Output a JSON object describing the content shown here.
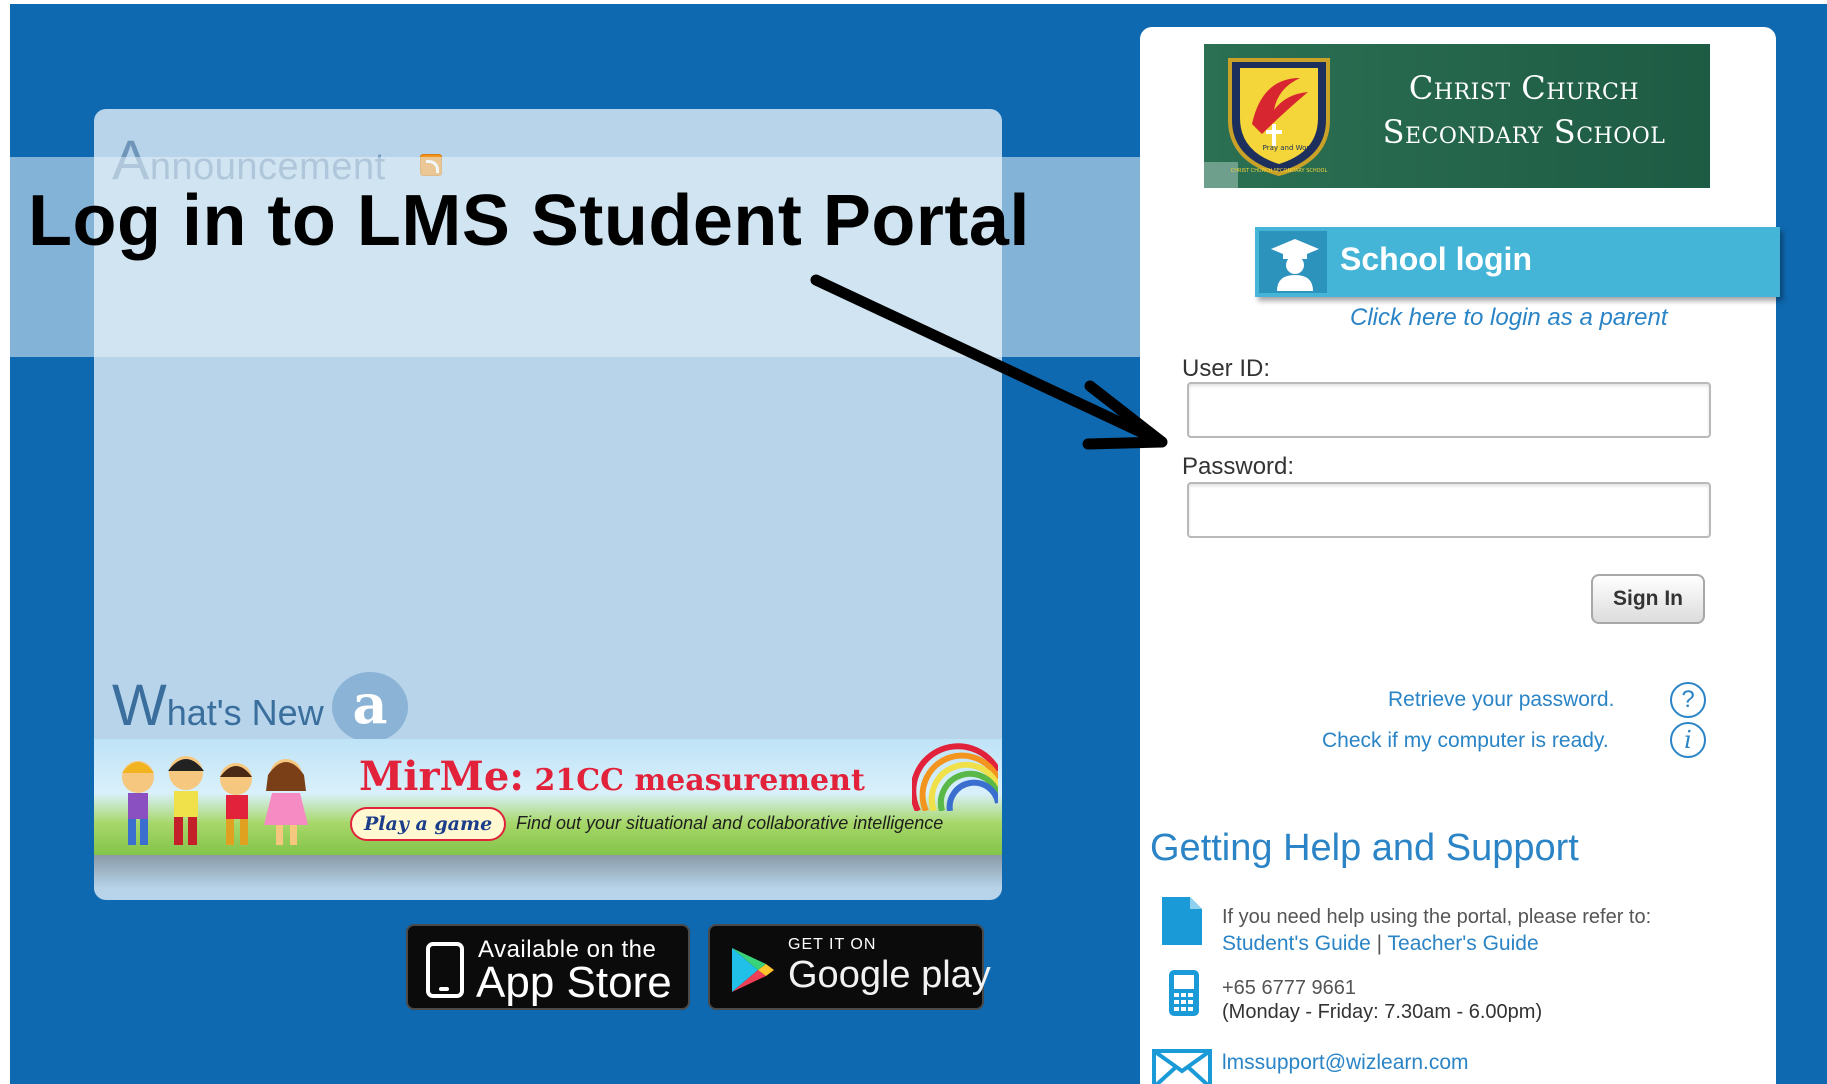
{
  "overlay": {
    "title": "Log in to LMS Student Portal"
  },
  "announcements": {
    "title_first_letter": "A",
    "title_rest": "nnouncement",
    "whats_new_first_letter": "W",
    "whats_new_rest": "hat's New",
    "whats_new_badge": "a"
  },
  "banner": {
    "title_main": "MirMe:",
    "title_sub": " 21CC measurement",
    "play_button": "Play a game",
    "tagline": "Find out your situational and collaborative intelligence"
  },
  "stores": {
    "appstore_line1": "Available on the",
    "appstore_line2": "App Store",
    "googleplay_line1": "GET IT ON",
    "googleplay_line2": "Google play"
  },
  "login": {
    "school_name_line1": "Christ Church",
    "school_name_line2": "Secondary School",
    "crest_motto": "Pray and Work",
    "crest_ring": "CHRIST CHURCH SECONDARY SCHOOL",
    "school_login_label": "School login",
    "parent_link": "Click here to login as a parent",
    "userid_label": "User ID:",
    "userid_value": "",
    "password_label": "Password:",
    "password_value": "",
    "signin_label": "Sign In",
    "retrieve_password": "Retrieve your password.",
    "check_computer": "Check if my computer is ready.",
    "question_icon_glyph": "?",
    "info_icon_glyph": "i"
  },
  "support": {
    "heading": "Getting Help and Support",
    "help_text": "If you need help using the portal, please refer to:",
    "student_guide": "Student's Guide",
    "separator": " | ",
    "teacher_guide": "Teacher's Guide",
    "phone": "+65 6777 9661",
    "hours": "(Monday - Friday: 7.30am - 6.00pm)",
    "email": "lmssupport@wizlearn.com"
  },
  "colors": {
    "page_blue": "#0f69b1",
    "panel_blue": "#b7d4ea",
    "link_blue": "#2a84c6",
    "tab_cyan": "#45b5d7",
    "school_green": "#21624a"
  }
}
